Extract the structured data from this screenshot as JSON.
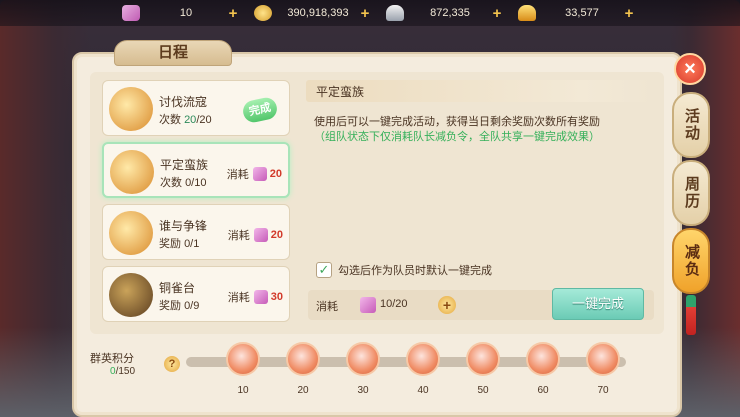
{
  "topbar": {
    "resources": [
      {
        "icon": "bag-icon",
        "value": "10"
      },
      {
        "icon": "coin-icon",
        "value": "390,918,393"
      },
      {
        "icon": "silver-ingot-icon",
        "value": "872,335"
      },
      {
        "icon": "gold-ingot-icon",
        "value": "33,577"
      }
    ],
    "plus_label": "+"
  },
  "panel": {
    "title": "日程",
    "close_label": "×"
  },
  "tasks": [
    {
      "name": "讨伐流寇",
      "count_label": "次数",
      "count_current": "20",
      "count_rest": "/20",
      "status": "完成"
    },
    {
      "name": "平定蛮族",
      "count_label": "次数",
      "count_value": "0/10",
      "cost_label": "消耗",
      "cost_value": "20"
    },
    {
      "name": "谁与争锋",
      "count_label": "奖励",
      "count_value": "0/1",
      "cost_label": "消耗",
      "cost_value": "20"
    },
    {
      "name": "铜雀台",
      "count_label": "奖励",
      "count_value": "0/9",
      "cost_label": "消耗",
      "cost_value": "30"
    }
  ],
  "detail": {
    "title": "平定蛮族",
    "description": "使用后可以一键完成活动，获得当日剩余奖励次数所有奖励",
    "note": "（组队状态下仅消耗队长减负令，全队共享一键完成效果）",
    "checkbox_label": "勾选后作为队员时默认一键完成",
    "checkbox_checked": true,
    "cost_label": "消耗",
    "cost_value": "10/20",
    "action_button": "一键完成"
  },
  "score": {
    "label": "群英积分",
    "current": "0",
    "total": "/150",
    "help": "?",
    "milestones": [
      "10",
      "20",
      "30",
      "40",
      "50",
      "60",
      "70"
    ]
  },
  "sidetabs": [
    "活动",
    "周历",
    "减负"
  ],
  "colors": {
    "accent_green": "#35b05a",
    "cost_red": "#d23a2a",
    "active_tab": "#f0a22a"
  }
}
